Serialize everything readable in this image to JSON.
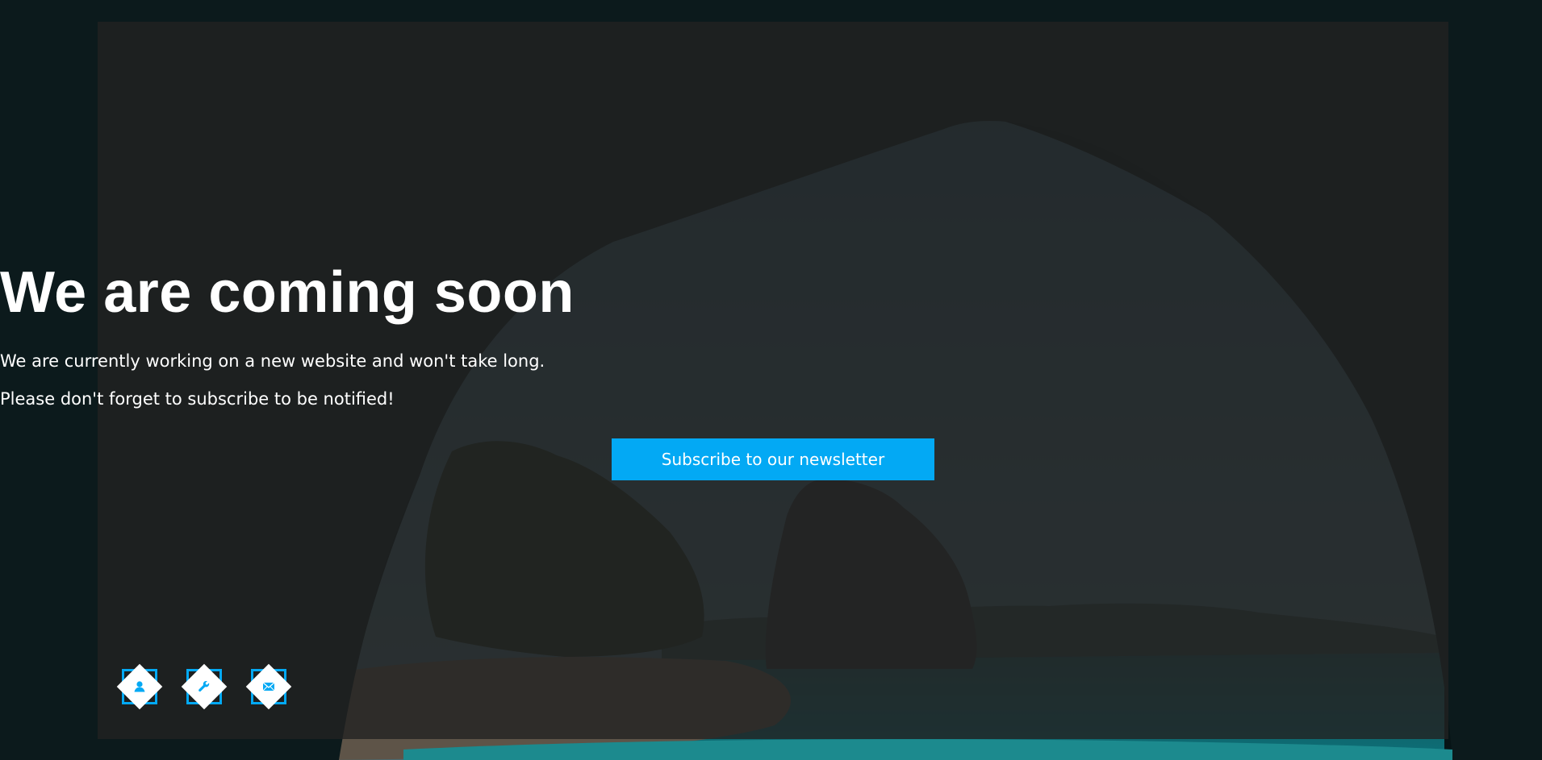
{
  "hero": {
    "headline": "We are coming soon",
    "line1": "We are currently working on a new website and won't take long.",
    "line2": "Please don't forget to subscribe to be notified!",
    "subscribe_label": "Subscribe to our newsletter"
  },
  "social_links": [
    {
      "icon": "user-icon"
    },
    {
      "icon": "wrench-icon"
    },
    {
      "icon": "envelope-icon"
    }
  ],
  "colors": {
    "accent": "#03a9f4",
    "panel": "#222222",
    "text": "#ffffff"
  }
}
